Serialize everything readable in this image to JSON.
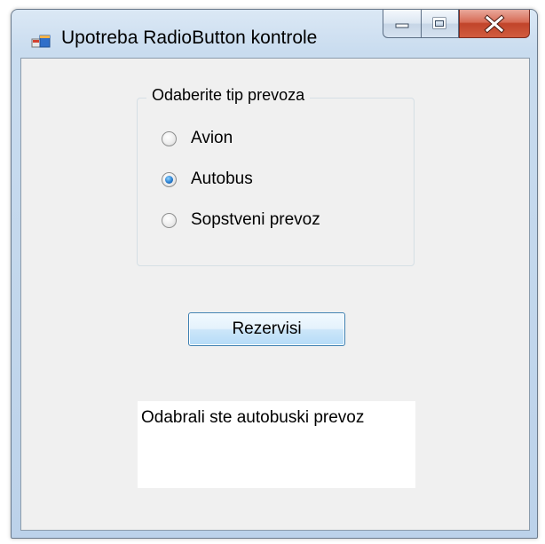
{
  "window": {
    "title": "Upotreba RadioButton kontrole",
    "controls": {
      "minimize": "minimize",
      "maximize": "maximize",
      "close": "close"
    }
  },
  "groupbox": {
    "title": "Odaberite tip prevoza",
    "options": [
      {
        "label": "Avion",
        "checked": false
      },
      {
        "label": "Autobus",
        "checked": true
      },
      {
        "label": "Sopstveni prevoz",
        "checked": false
      }
    ]
  },
  "button": {
    "label": "Rezervisi"
  },
  "result": {
    "text": "Odabrali ste autobuski prevoz"
  },
  "icons": {
    "app": "windows-form-icon",
    "minimize": "minimize-icon",
    "maximize": "maximize-icon",
    "close": "close-icon"
  },
  "colors": {
    "close_button": "#c1442a",
    "radio_selected": "#2a7fd0",
    "button_border": "#3c7fb1"
  }
}
